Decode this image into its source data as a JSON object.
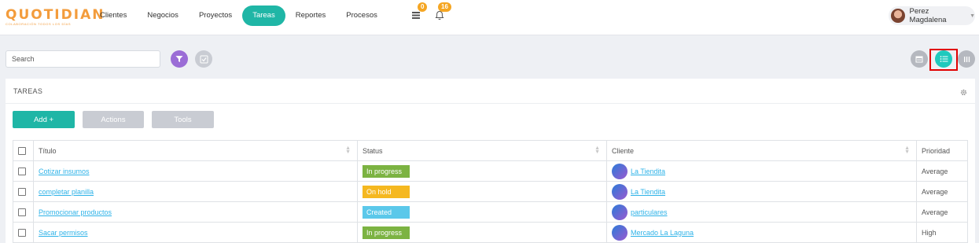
{
  "brand": {
    "name": "QUOTIDIAN",
    "tagline": "COLABORACIÓN TODOS LOS DÍAS",
    "color": "#f39c3c"
  },
  "nav": {
    "items": [
      {
        "label": "Clientes"
      },
      {
        "label": "Negocios"
      },
      {
        "label": "Proyectos"
      },
      {
        "label": "Tareas",
        "active": true
      },
      {
        "label": "Reportes"
      },
      {
        "label": "Procesos"
      }
    ],
    "tasks_icon_badge": "0",
    "notifications_badge": "16"
  },
  "user": {
    "name": "Perez Magdalena"
  },
  "search": {
    "placeholder": "Search"
  },
  "view_modes": [
    "calendar-view",
    "list-view",
    "kanban-view"
  ],
  "panel": {
    "title": "TAREAS",
    "buttons": {
      "add": "Add +",
      "actions": "Actions",
      "tools": "Tools"
    }
  },
  "table": {
    "headers": {
      "title": "Título",
      "status": "Status",
      "client": "Cliente",
      "priority": "Prioridad"
    },
    "rows": [
      {
        "title": "Cotizar insumos",
        "status": "In progress",
        "status_color": "#7cb342",
        "client": "La Tiendita",
        "priority": "Average"
      },
      {
        "title": "completar planilla",
        "status": "On hold",
        "status_color": "#f5b820",
        "client": "La Tiendita",
        "priority": "Average"
      },
      {
        "title": "Promocionar productos",
        "status": "Created",
        "status_color": "#5bc8ea",
        "client": "particulares",
        "priority": "Average"
      },
      {
        "title": "Sacar permisos",
        "status": "In progress",
        "status_color": "#7cb342",
        "client": "Mercado La Laguna",
        "priority": "High"
      }
    ]
  },
  "colors": {
    "accent": "#1fb6a6",
    "filter": "#9b6dd6",
    "muted_button": "#c9ccd3",
    "highlight": "#e00000"
  }
}
